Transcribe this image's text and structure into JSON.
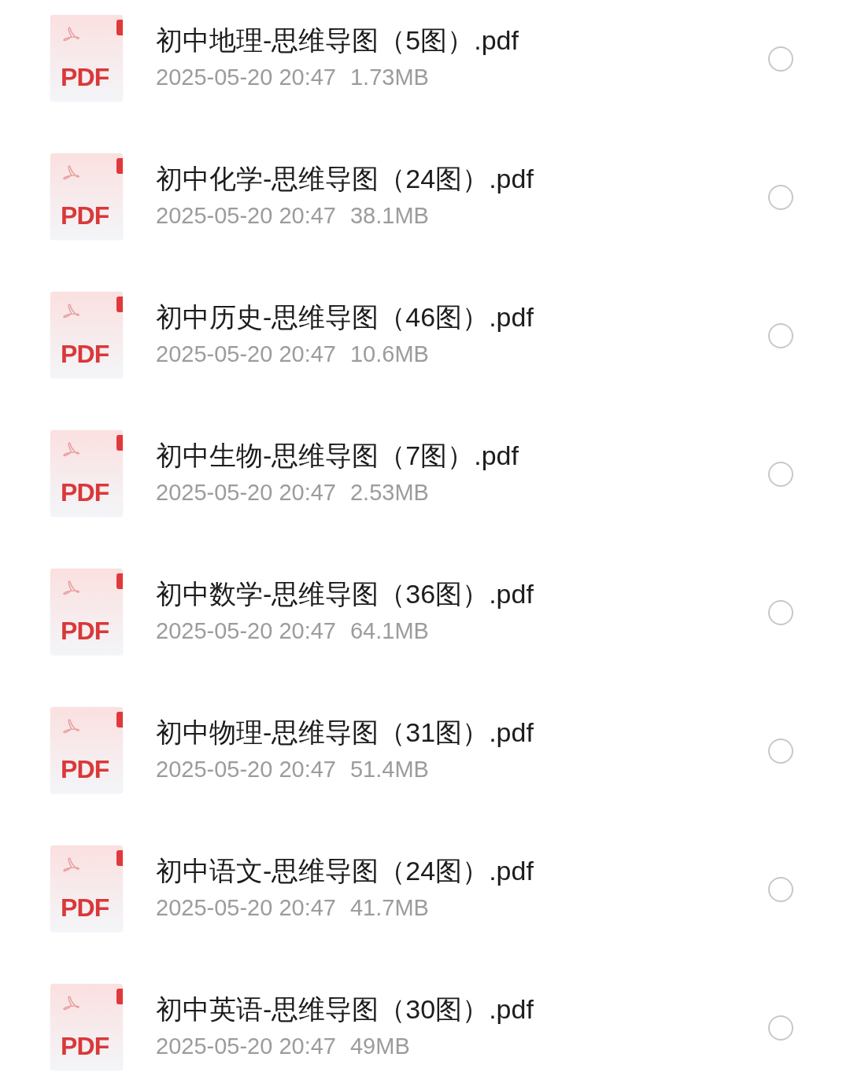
{
  "files": [
    {
      "name": "初中地理-思维导图（5图）.pdf",
      "icon_label": "PDF",
      "date": "2025-05-20 20:47",
      "size": "1.73MB",
      "selected": false
    },
    {
      "name": "初中化学-思维导图（24图）.pdf",
      "icon_label": "PDF",
      "date": "2025-05-20 20:47",
      "size": "38.1MB",
      "selected": false
    },
    {
      "name": "初中历史-思维导图（46图）.pdf",
      "icon_label": "PDF",
      "date": "2025-05-20 20:47",
      "size": "10.6MB",
      "selected": false
    },
    {
      "name": "初中生物-思维导图（7图）.pdf",
      "icon_label": "PDF",
      "date": "2025-05-20 20:47",
      "size": "2.53MB",
      "selected": false
    },
    {
      "name": "初中数学-思维导图（36图）.pdf",
      "icon_label": "PDF",
      "date": "2025-05-20 20:47",
      "size": "64.1MB",
      "selected": false
    },
    {
      "name": "初中物理-思维导图（31图）.pdf",
      "icon_label": "PDF",
      "date": "2025-05-20 20:47",
      "size": "51.4MB",
      "selected": false
    },
    {
      "name": "初中语文-思维导图（24图）.pdf",
      "icon_label": "PDF",
      "date": "2025-05-20 20:47",
      "size": "41.7MB",
      "selected": false
    },
    {
      "name": "初中英语-思维导图（30图）.pdf",
      "icon_label": "PDF",
      "date": "2025-05-20 20:47",
      "size": "49MB",
      "selected": false
    }
  ]
}
